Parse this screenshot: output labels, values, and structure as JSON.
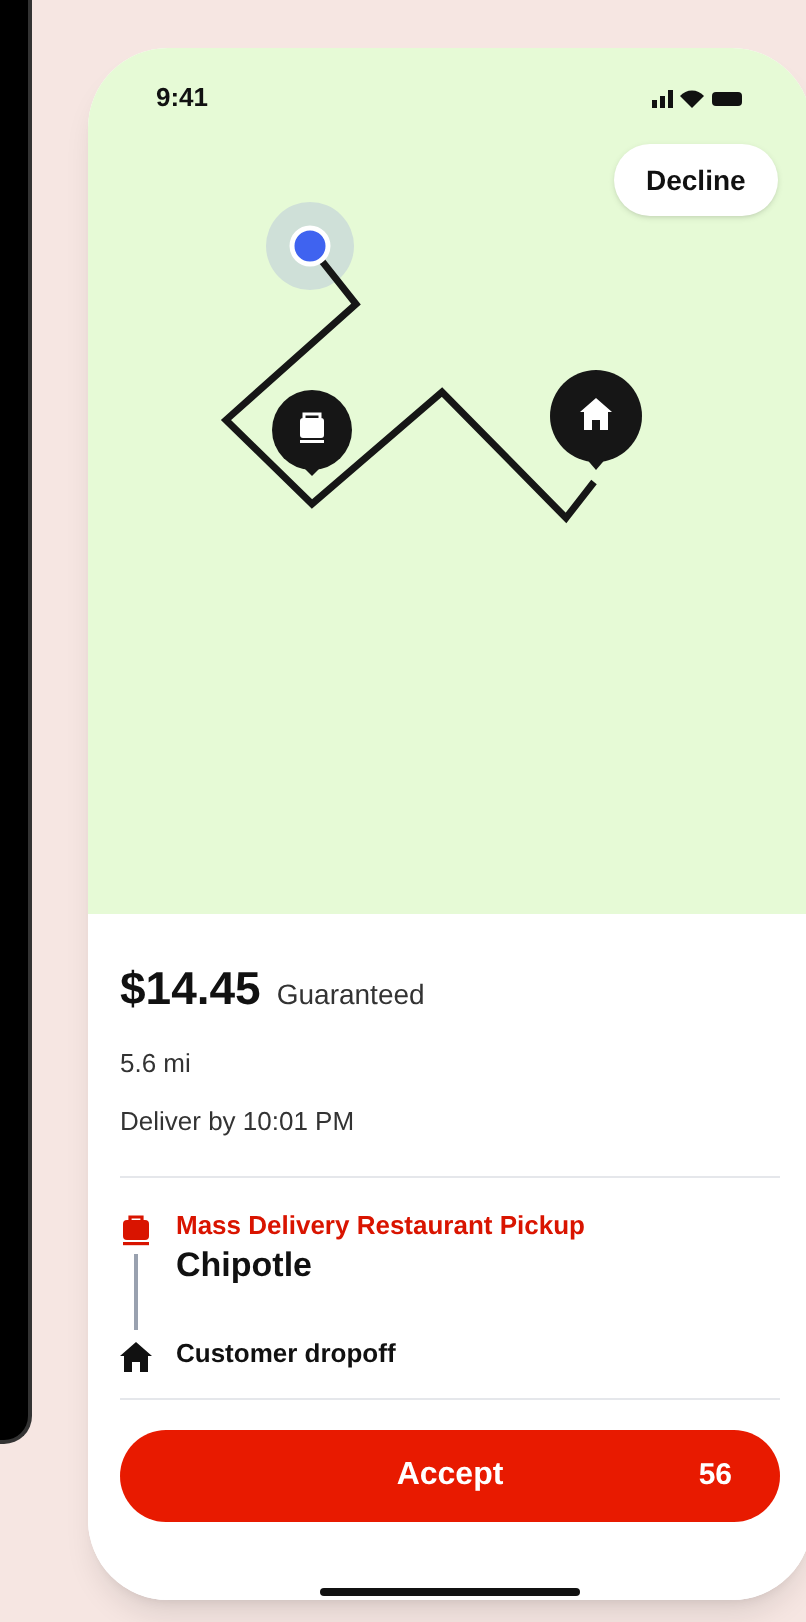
{
  "status_bar": {
    "time": "9:41"
  },
  "map": {
    "decline": "Decline"
  },
  "offer": {
    "price": "$14.45",
    "price_note": "Guaranteed",
    "distance": "5.6 mi",
    "deliver_by": "Deliver by 10:01 PM"
  },
  "stops": [
    {
      "kind": "pickup",
      "label": "Mass Delivery Restaurant Pickup",
      "name": "Chipotle"
    },
    {
      "kind": "dropoff",
      "label": "Customer dropoff"
    }
  ],
  "accept": {
    "label": "Accept",
    "count": "56"
  }
}
